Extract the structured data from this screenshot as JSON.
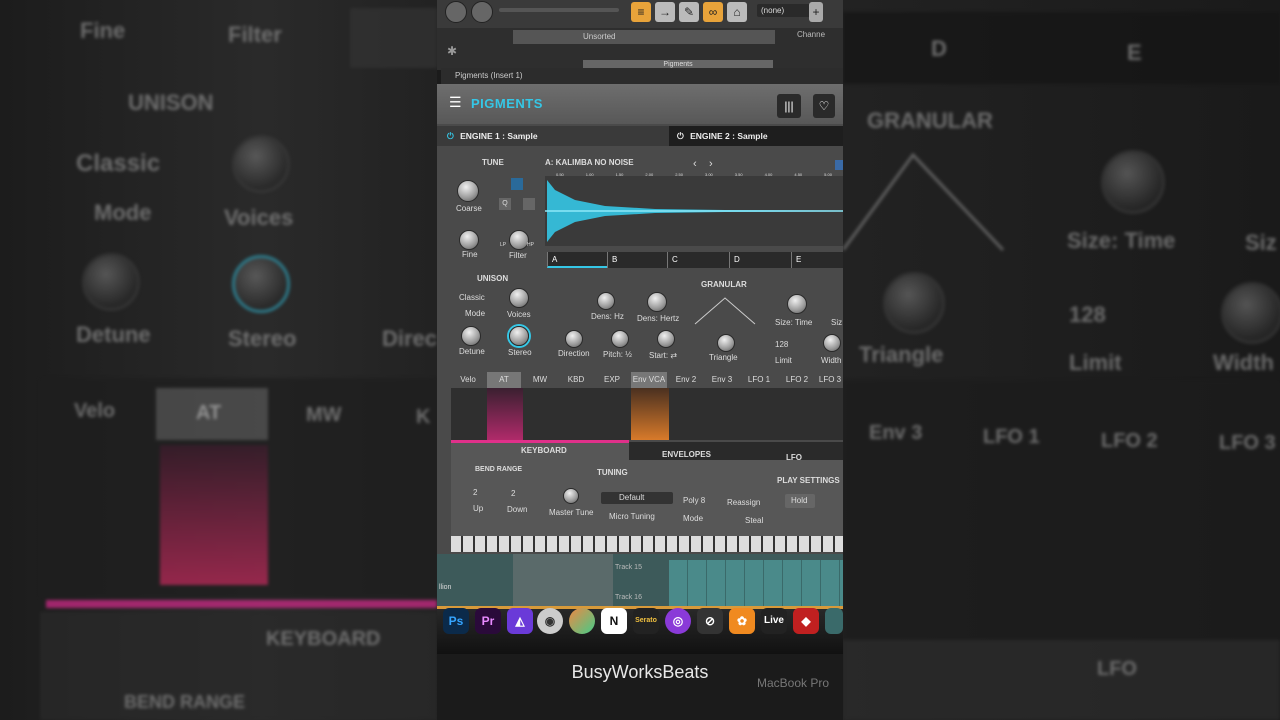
{
  "background_left": {
    "labels": [
      "Fine",
      "Filter",
      "UNISON",
      "Classic",
      "Mode",
      "Voices",
      "Detune",
      "Stereo",
      "Direc",
      "Velo",
      "AT",
      "MW",
      "K",
      "KEYBOARD",
      "BEND RANGE"
    ]
  },
  "background_right": {
    "labels": [
      "D",
      "E",
      "GRANULAR",
      "Size: Time",
      "Siz",
      "Triangle",
      "128",
      "Limit",
      "Width",
      "Env 3",
      "LFO 1",
      "LFO 2",
      "LFO 3",
      "LFO"
    ]
  },
  "daw": {
    "pattern_dropdown": "(none)",
    "browser_label": "Unsorted",
    "channel_label": "Channe",
    "plugin_slot": "Pigments",
    "plugin_window_title": "Pigments (Insert 1)",
    "tracks": [
      "Track 15",
      "Track 16"
    ],
    "left_text": "llion"
  },
  "pigments": {
    "logo": "PIGMENTS",
    "engine1": "ENGINE 1 : Sample",
    "engine2": "ENGINE 2 : Sample",
    "tune": "TUNE",
    "coarse": "Coarse",
    "fine": "Fine",
    "filter": "Filter",
    "filter_lp": "LP",
    "filter_hp": "HP",
    "q_label": "Q",
    "sample_name": "A: KALIMBA NO NOISE",
    "ruler_ticks": [
      "0.50",
      "1.00",
      "1.50",
      "2.00",
      "2.50",
      "3.00",
      "3.50",
      "4.00",
      "4.50",
      "5.00"
    ],
    "segments": [
      "A",
      "B",
      "C",
      "D",
      "E"
    ],
    "unison": "UNISON",
    "unison_mode": "Classic",
    "mode": "Mode",
    "voices": "Voices",
    "detune": "Detune",
    "stereo": "Stereo",
    "granular": "GRANULAR",
    "dens_fixed": "Dens: Hz",
    "dens_hertz": "Dens: Hertz",
    "size_time": "Size: Time",
    "size_short": "Siz",
    "direction": "Direction",
    "pitch": "Pitch: ½",
    "start": "Start: ⇄",
    "triangle": "Triangle",
    "limit_value": "128",
    "limit": "Limit",
    "width": "Width",
    "mod_tabs": [
      "Velo",
      "AT",
      "MW",
      "KBD",
      "EXP",
      "Env VCA",
      "Env 2",
      "Env 3",
      "LFO 1",
      "LFO 2",
      "LFO 3"
    ],
    "sections": [
      "KEYBOARD",
      "ENVELOPES",
      "LFO"
    ],
    "bend_range": "BEND RANGE",
    "bend_up_value": "2",
    "bend_down_value": "2",
    "up": "Up",
    "down": "Down",
    "tuning": "TUNING",
    "master_tune": "Master Tune",
    "tuning_default": "Default",
    "micro_tuning": "Micro Tuning",
    "play_settings": "PLAY SETTINGS",
    "poly": "Poly 8",
    "reassign": "Reassign",
    "mode_label": "Mode",
    "steal": "Steal",
    "hold": "Hold"
  },
  "dock": {
    "apps": [
      "Ps",
      "Pr",
      "",
      "",
      "",
      "N",
      "Serato",
      "",
      "",
      "",
      "Live",
      "",
      ""
    ]
  },
  "credit": "BusyWorksBeats",
  "device": "MacBook Pro"
}
